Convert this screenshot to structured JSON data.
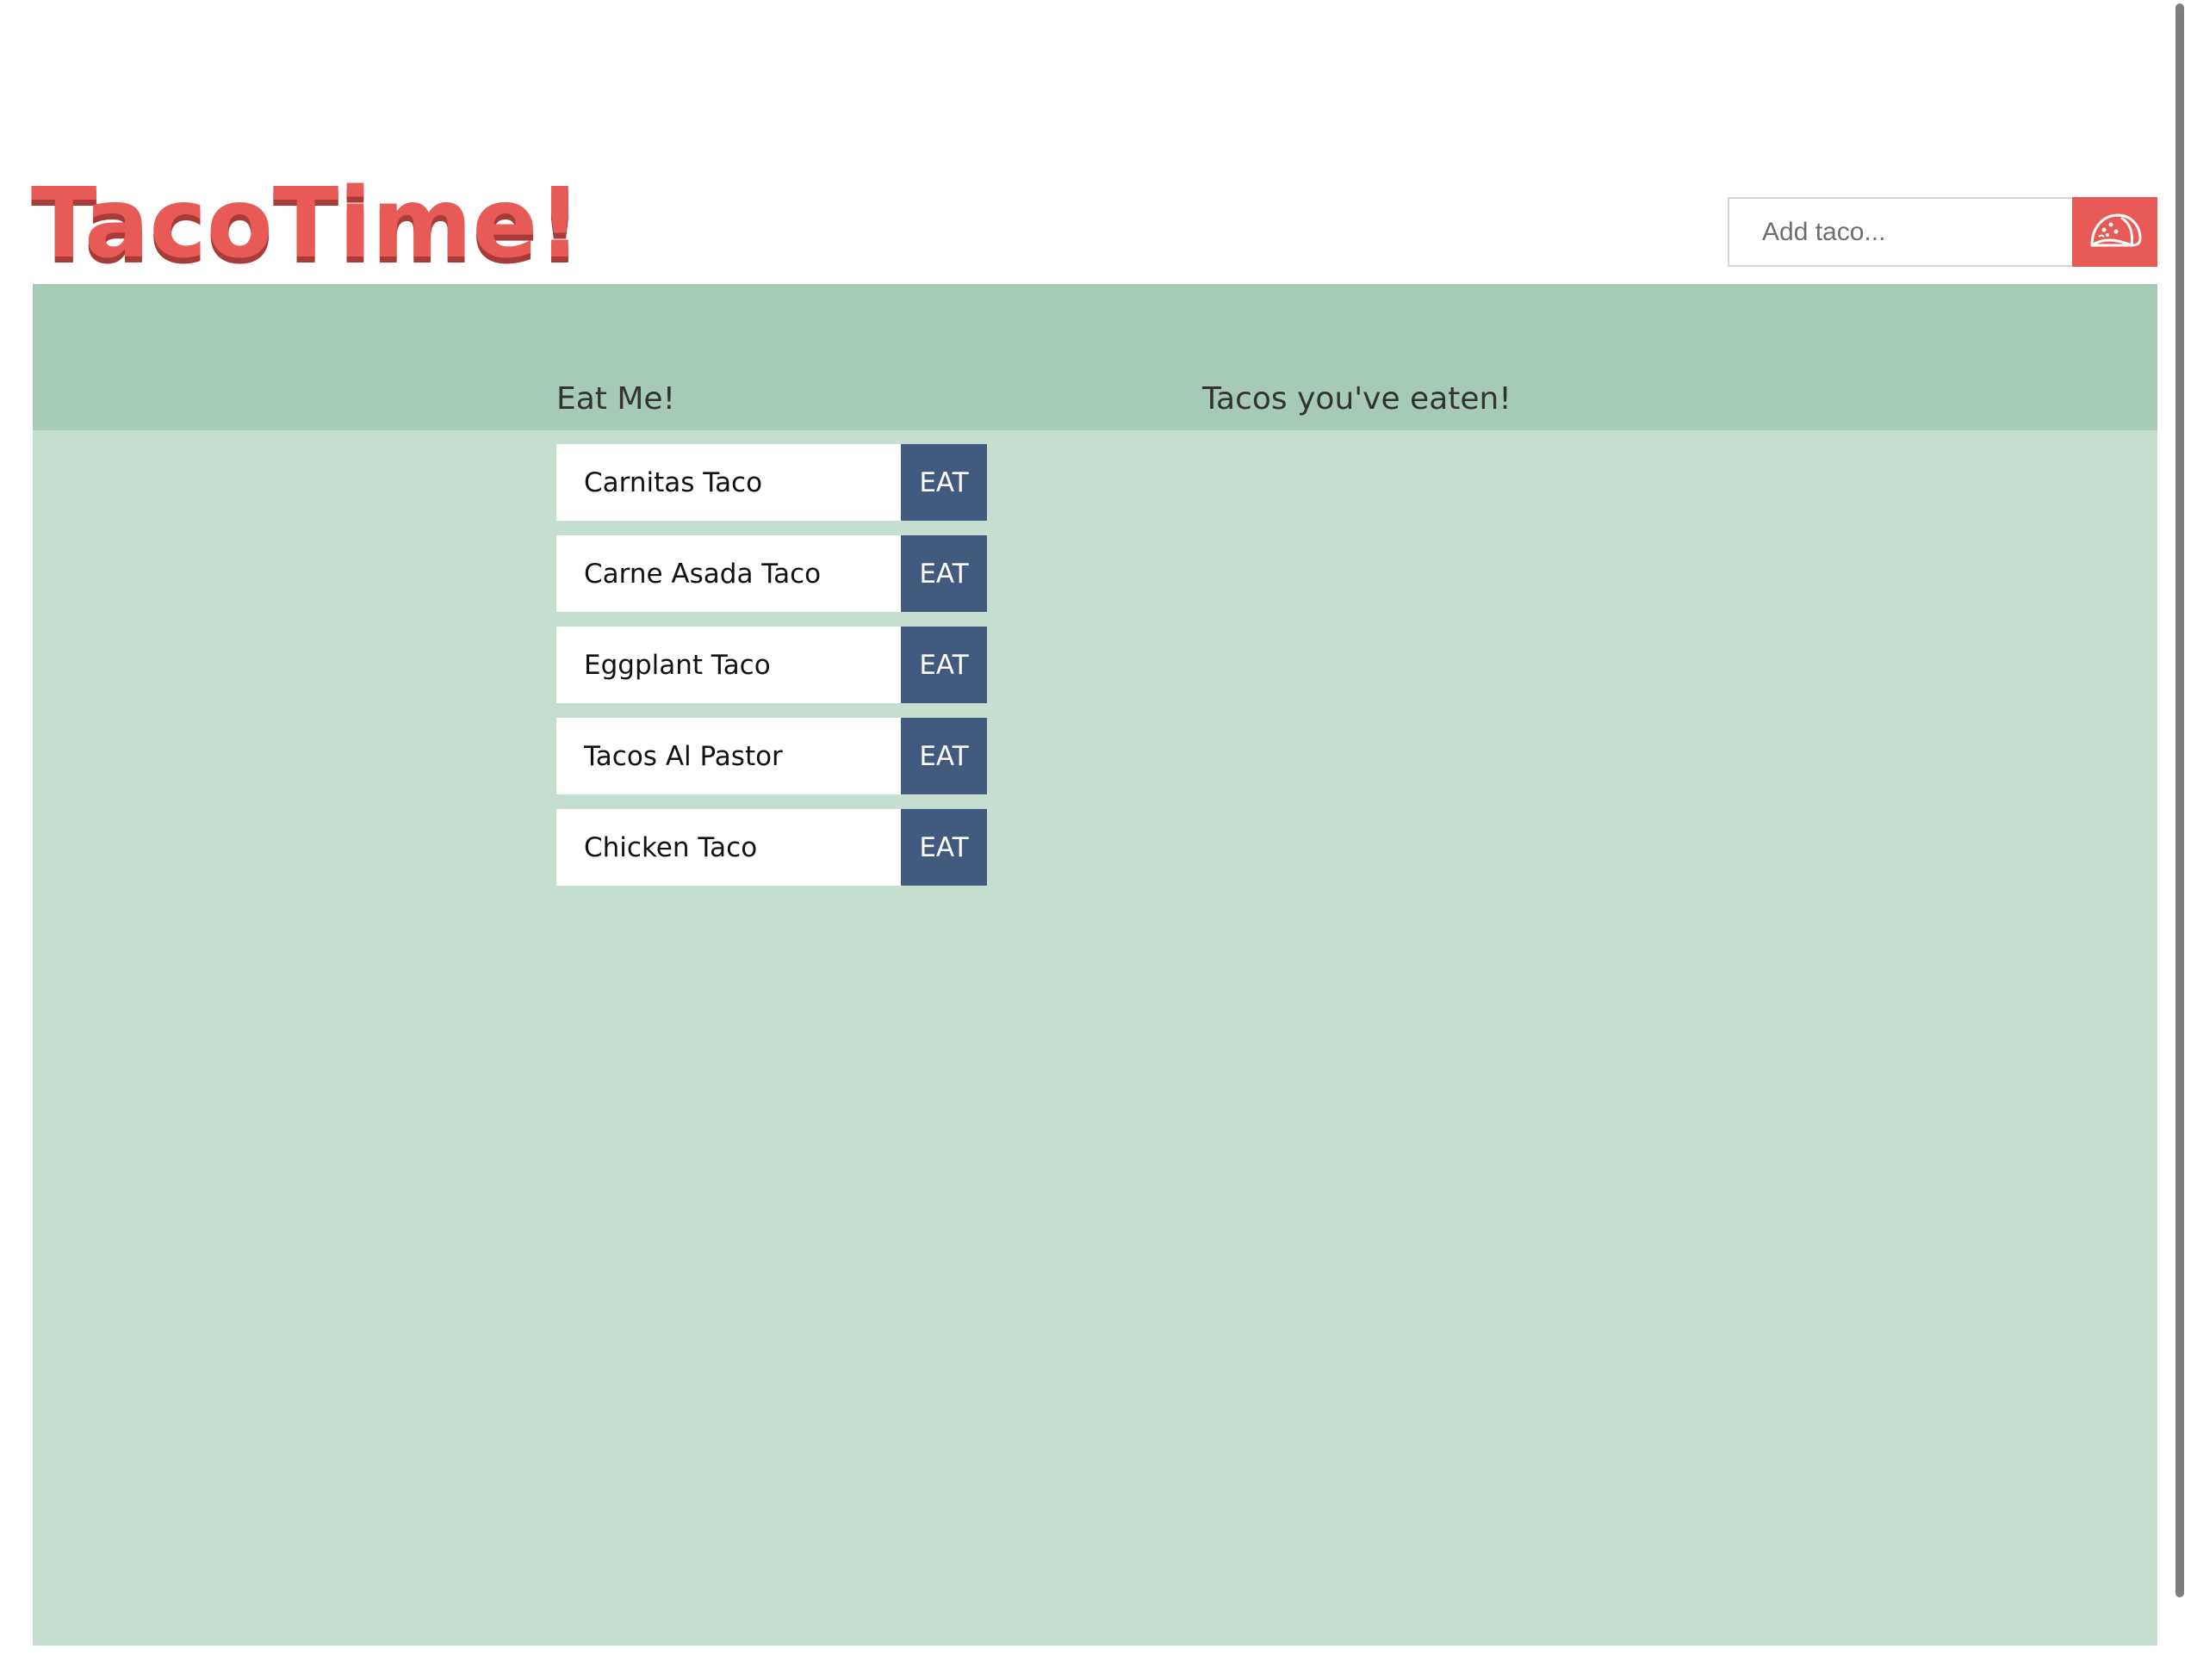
{
  "app": {
    "logo_text": "TacoTime!"
  },
  "add_form": {
    "placeholder": "Add taco...",
    "submit_icon": "taco-icon"
  },
  "columns": {
    "left_title": "Eat Me!",
    "right_title": "Tacos you've eaten!"
  },
  "tacos": [
    {
      "name": "Carnitas Taco",
      "action": "EAT"
    },
    {
      "name": "Carne Asada Taco",
      "action": "EAT"
    },
    {
      "name": "Eggplant Taco",
      "action": "EAT"
    },
    {
      "name": "Tacos Al Pastor",
      "action": "EAT"
    },
    {
      "name": "Chicken Taco",
      "action": "EAT"
    }
  ],
  "eaten": [],
  "colors": {
    "brand": "#e85a56",
    "header_band": "#a6cab5",
    "content_bg": "#c5ded0",
    "eat_button": "#435a80"
  }
}
